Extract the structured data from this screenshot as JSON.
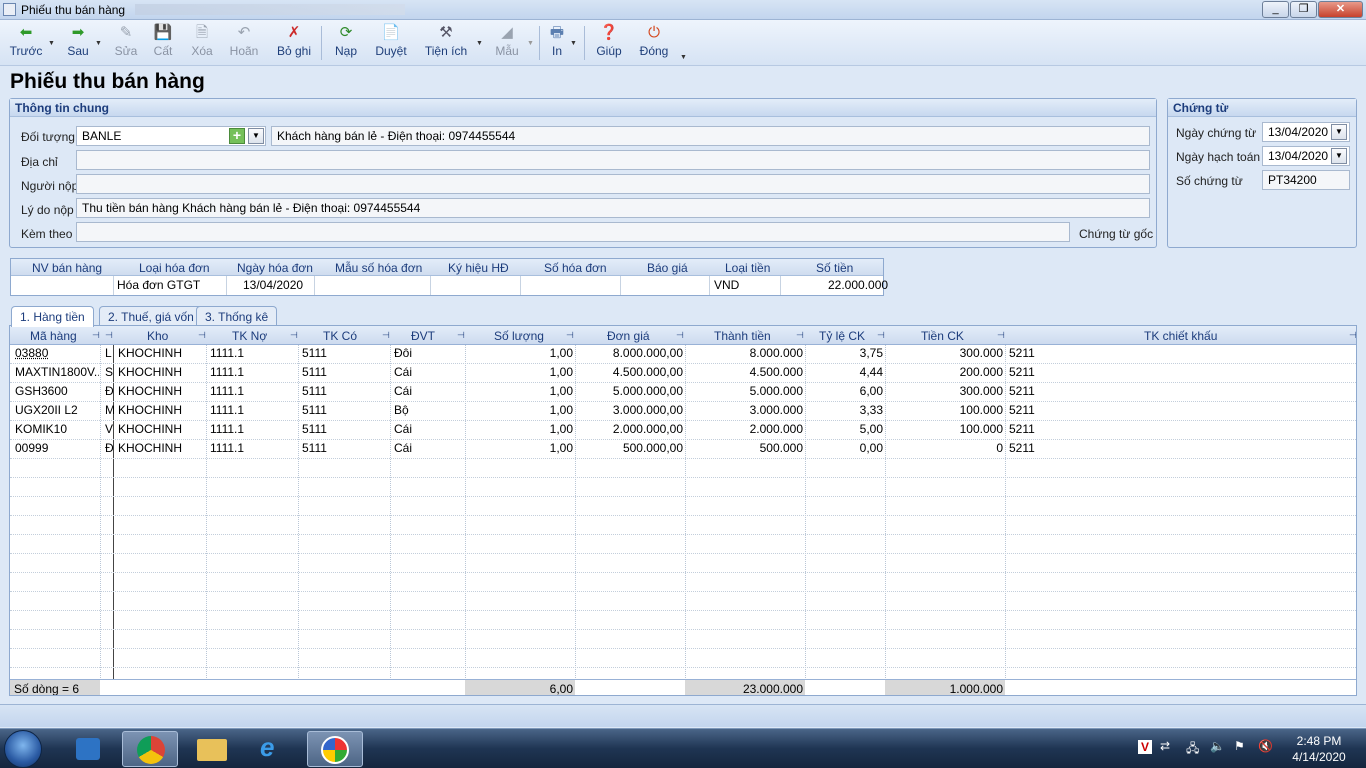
{
  "window": {
    "title": "Phiếu thu bán hàng"
  },
  "toolbar": {
    "items": [
      {
        "label": "Trước"
      },
      {
        "label": "Sau"
      },
      {
        "label": "Sửa"
      },
      {
        "label": "Cất"
      },
      {
        "label": "Xóa"
      },
      {
        "label": "Hoãn"
      },
      {
        "label": "Bỏ ghi"
      },
      {
        "label": "Nạp"
      },
      {
        "label": "Duyệt"
      },
      {
        "label": "Tiện ích"
      },
      {
        "label": "Mẫu"
      },
      {
        "label": "In"
      },
      {
        "label": "Giúp"
      },
      {
        "label": "Đóng"
      }
    ]
  },
  "page": {
    "title": "Phiếu thu bán hàng"
  },
  "general": {
    "header": "Thông tin chung",
    "doi_tuong_label": "Đối tượng",
    "doi_tuong_value": "BANLE",
    "doi_tuong_desc": "Khách hàng bán lẻ - Điện thoại: 0974455544",
    "dia_chi_label": "Địa chỉ",
    "dia_chi_value": "",
    "nguoi_nop_label": "Người nộp",
    "nguoi_nop_value": "",
    "ly_do_label": "Lý do nộp",
    "ly_do_value": "Thu tiền bán hàng Khách hàng bán lẻ - Điện thoại: 0974455544",
    "kem_theo_label": "Kèm theo",
    "kem_theo_value": "",
    "chung_tu_goc_label": "Chứng từ gốc"
  },
  "voucher": {
    "header": "Chứng từ",
    "ngay_chung_tu_label": "Ngày chứng từ",
    "ngay_chung_tu": "13/04/2020",
    "ngay_hach_toan_label": "Ngày hạch toán",
    "ngay_hach_toan": "13/04/2020",
    "so_chung_tu_label": "Số chứng từ",
    "so_chung_tu": "PT34200"
  },
  "invoice": {
    "headers": [
      "NV bán hàng",
      "Loại hóa đơn",
      "Ngày hóa đơn",
      "Mẫu số hóa đơn",
      "Ký hiệu HĐ",
      "Số hóa đơn",
      "Báo giá",
      "Loại tiền",
      "Số tiền"
    ],
    "row": [
      "",
      "Hóa đơn GTGT",
      "13/04/2020",
      "",
      "",
      "",
      "",
      "VND",
      "22.000.000"
    ]
  },
  "tabs": [
    {
      "label": "1. Hàng tiền"
    },
    {
      "label": "2. Thuế, giá vốn"
    },
    {
      "label": "3. Thống kê"
    }
  ],
  "grid": {
    "headers": [
      "Mã hàng",
      "",
      "Kho",
      "TK Nợ",
      "TK Có",
      "ĐVT",
      "Số lượng",
      "Đơn giá",
      "Thành tiền",
      "Tỷ lệ CK",
      "Tiền CK",
      "TK chiết khấu"
    ],
    "rows": [
      [
        "03880",
        "L",
        "KHOCHINH",
        "1111.1",
        "5111",
        "Đôi",
        "1,00",
        "8.000.000,00",
        "8.000.000",
        "3,75",
        "300.000",
        "5211"
      ],
      [
        "MAXTIN1800V...",
        "S",
        "KHOCHINH",
        "1111.1",
        "5111",
        "Cái",
        "1,00",
        "4.500.000,00",
        "4.500.000",
        "4,44",
        "200.000",
        "5211"
      ],
      [
        "GSH3600",
        "Đ",
        "KHOCHINH",
        "1111.1",
        "5111",
        "Cái",
        "1,00",
        "5.000.000,00",
        "5.000.000",
        "6,00",
        "300.000",
        "5211"
      ],
      [
        "UGX20II L2",
        "M",
        "KHOCHINH",
        "1111.1",
        "5111",
        "Bộ",
        "1,00",
        "3.000.000,00",
        "3.000.000",
        "3,33",
        "100.000",
        "5211"
      ],
      [
        "KOMIK10",
        "V",
        "KHOCHINH",
        "1111.1",
        "5111",
        "Cái",
        "1,00",
        "2.000.000,00",
        "2.000.000",
        "5,00",
        "100.000",
        "5211"
      ],
      [
        "00999",
        "Đ",
        "KHOCHINH",
        "1111.1",
        "5111",
        "Cái",
        "1,00",
        "500.000,00",
        "500.000",
        "0,00",
        "0",
        "5211"
      ]
    ],
    "footer": {
      "row_count": "Số dòng = 6",
      "so_luong": "6,00",
      "thanh_tien": "23.000.000",
      "tien_ck": "1.000.000"
    }
  },
  "taskbar": {
    "time": "2:48 PM",
    "date": "4/14/2020"
  }
}
